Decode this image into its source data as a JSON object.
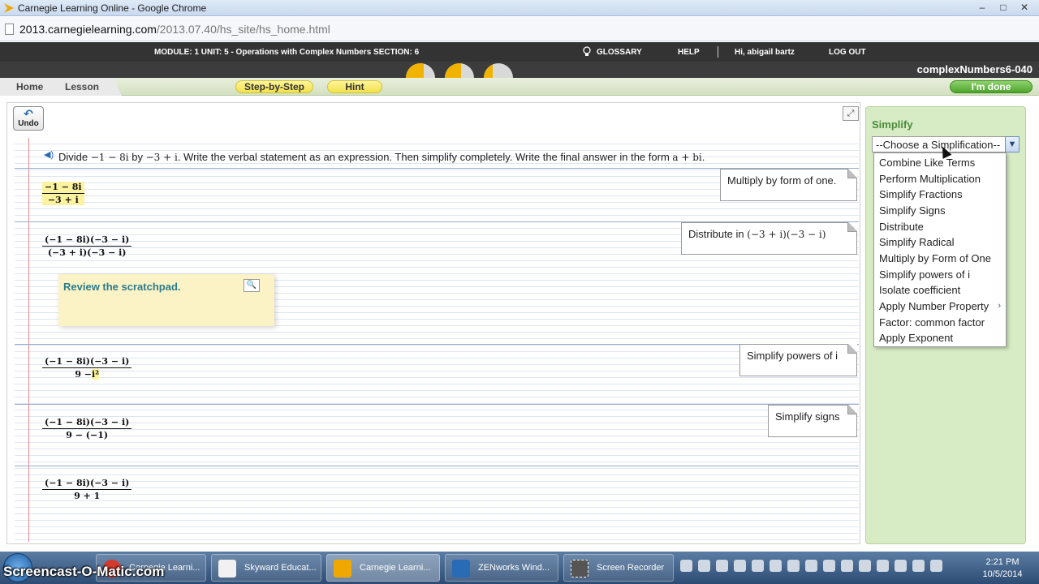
{
  "browser": {
    "window_title": "Carnegie Learning Online - Google Chrome",
    "url_host": "2013.carnegielearning.com",
    "url_path": "/2013.07.40/hs_site/hs_home.html",
    "win_buttons": {
      "minimize": "–",
      "maximize": "□",
      "close": "✕"
    }
  },
  "module_bar": {
    "module_text": "MODULE: 1 UNIT: 5 - Operations with Complex Numbers SECTION: 6",
    "glossary": "GLOSSARY",
    "help": "HELP",
    "user": "Hi, abigail bartz",
    "logout": "LOG OUT"
  },
  "problem_id": "complexNumbers6-040",
  "skill_meter": [
    0.62,
    0.55,
    0.3
  ],
  "nav": {
    "home": "Home",
    "lesson": "Lesson",
    "step_by_step": "Step-by-Step",
    "hint": "Hint",
    "done": "I'm done"
  },
  "toolbar": {
    "undo": "Undo"
  },
  "problem": {
    "divide": "Divide",
    "dividend": "−1 − 8i",
    "by": "by",
    "divisor": "−3 + i",
    "rest": ". Write the verbal statement as an expression. Then simplify completely. Write the final answer in the form",
    "form": "a + bi",
    "period": "."
  },
  "work_rows": [
    {
      "num": "−1 − 8i",
      "den": "−3 + i",
      "step": "Multiply by form of one."
    },
    {
      "num": "(−1 − 8i)(−3 − i)",
      "den": "(−3 + i)(−3 − i)",
      "step_prefix": "Distribute in",
      "step_math": "(−3 + i)(−3 − i)"
    },
    {
      "num": "(−1 − 8i)(−3 − i)",
      "den_prefix": "9 −",
      "den_hl": "i²",
      "step": "Simplify powers of i"
    },
    {
      "num": "(−1 − 8i)(−3 − i)",
      "den": "9 − (−1)",
      "step": "Simplify signs"
    },
    {
      "num": "(−1 − 8i)(−3 − i)",
      "den": "9 + 1"
    }
  ],
  "scratchpad": {
    "text": "Review the scratchpad."
  },
  "simplify_panel": {
    "heading": "Simplify",
    "select_value": "--Choose a Simplification--",
    "options": [
      "Combine Like Terms",
      "Perform Multiplication",
      "Simplify Fractions",
      "Simplify Signs",
      "Distribute",
      "Simplify Radical",
      "Multiply by Form of One",
      "Simplify powers of i",
      "Isolate coefficient",
      "Apply Number Property",
      "Factor: common factor",
      "Apply Exponent"
    ]
  },
  "taskbar": {
    "items": [
      "Carnegie Learni...",
      "Skyward Educat...",
      "Carnegie Learni...",
      "ZENworks Wind...",
      "Screen Recorder"
    ],
    "watermark": "Screencast-O-Matic.com",
    "time": "2:21 PM",
    "date": "10/5/2014"
  },
  "colors": {
    "accent_green": "#4c8b3d",
    "hint_yellow": "#f2e14a",
    "note_text": "#2c7b8b"
  }
}
